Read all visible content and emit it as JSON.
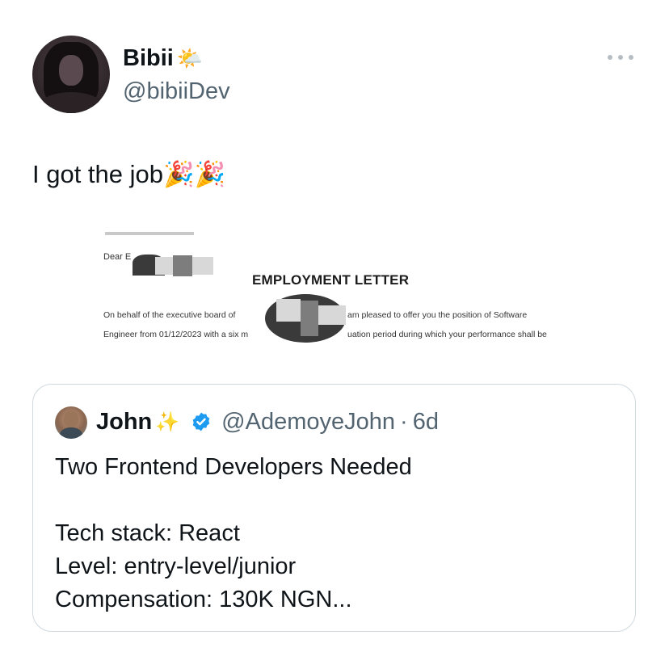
{
  "author": {
    "display_name": "Bibii",
    "name_emoji": "🌤️",
    "handle": "@bibiiDev"
  },
  "more_icon": "more-horizontal-icon",
  "tweet": {
    "text": "I got the job",
    "emojis": "🎉🎉"
  },
  "media": {
    "dear": "Dear E",
    "heading": "EMPLOYMENT LETTER",
    "line1_left": "On behalf of the executive board of",
    "line1_right": "am pleased to offer you the position of Software",
    "line2_left": "Engineer from 01/12/2023 with a six m",
    "line2_right": "uation period during which your performance shall be"
  },
  "quote": {
    "name": "John",
    "sparkle": "✨",
    "verified_icon": "verified-badge-icon",
    "verified_color": "#1d9bf0",
    "handle": "@AdemoyeJohn",
    "separator": "·",
    "time": "6d",
    "line1": "Two Frontend Developers Needed",
    "line2": "Tech stack: React",
    "line3": "Level: entry-level/junior",
    "line4": "Compensation: 130K NGN..."
  }
}
